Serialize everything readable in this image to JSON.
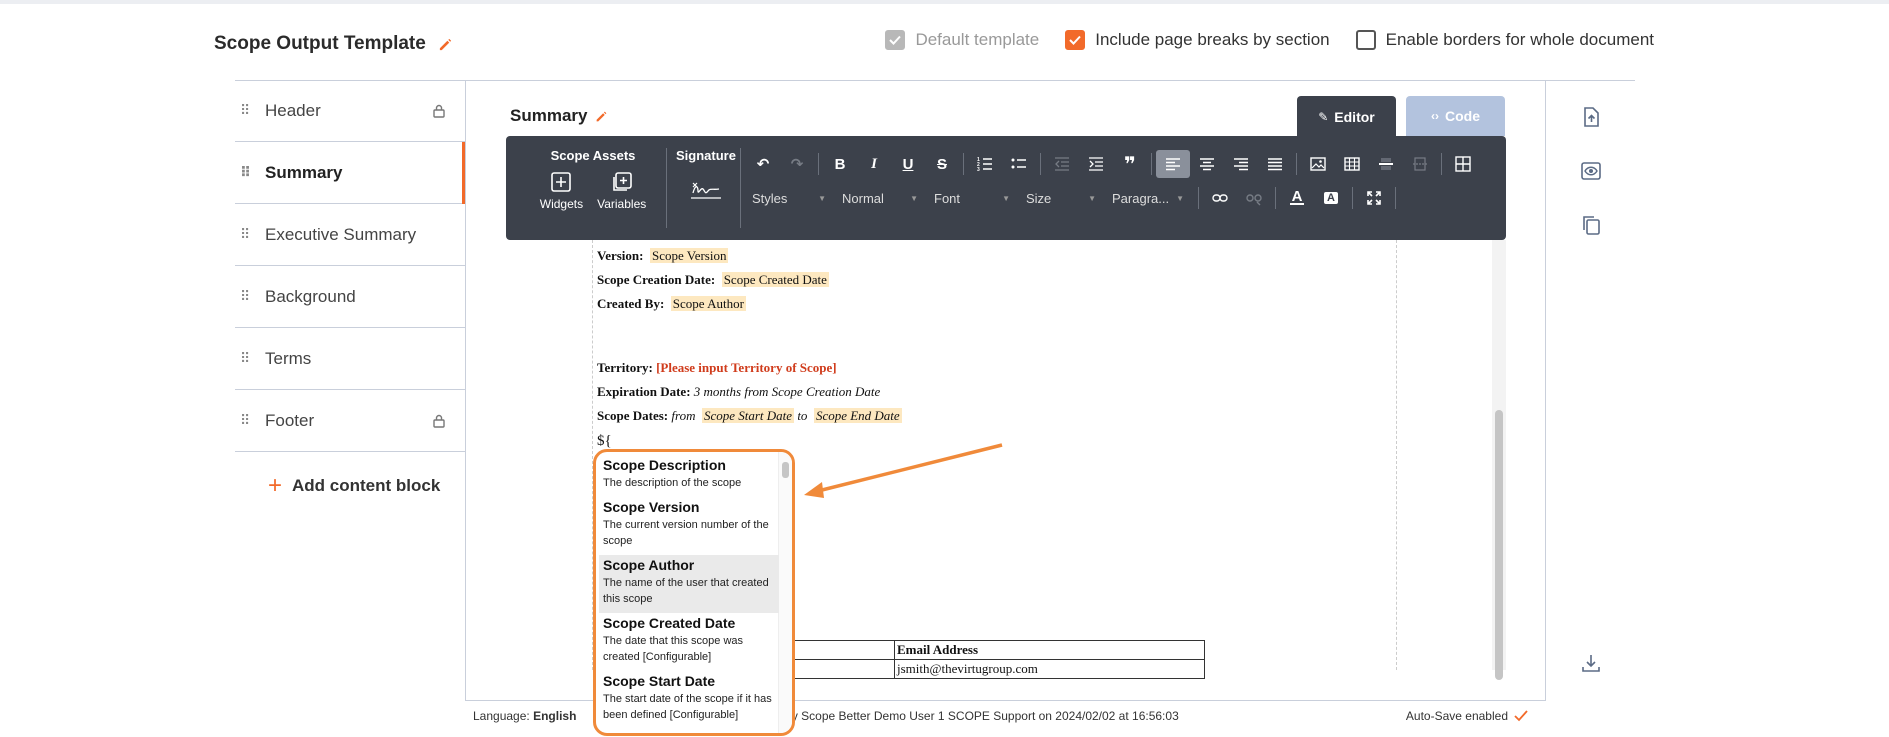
{
  "header": {
    "title": "Scope Output Template",
    "options": [
      {
        "label": "Default template",
        "checked": true,
        "disabled": true
      },
      {
        "label": "Include page breaks by section",
        "checked": true,
        "disabled": false
      },
      {
        "label": "Enable borders for whole document",
        "checked": false,
        "disabled": false
      }
    ]
  },
  "sidebar": {
    "items": [
      {
        "label": "Header",
        "locked": true
      },
      {
        "label": "Summary",
        "locked": false,
        "active": true
      },
      {
        "label": "Executive Summary",
        "locked": false
      },
      {
        "label": "Background",
        "locked": false
      },
      {
        "label": "Terms",
        "locked": false
      },
      {
        "label": "Footer",
        "locked": true
      }
    ],
    "add_label": "Add content block"
  },
  "editor": {
    "section_title": "Summary",
    "tabs": {
      "editor": "Editor",
      "code": "Code"
    },
    "toolbar": {
      "scope_assets": "Scope Assets",
      "widgets": "Widgets",
      "variables": "Variables",
      "signature": "Signature",
      "styles": "Styles",
      "format": "Normal",
      "font": "Font",
      "size": "Size",
      "paragraph": "Paragra..."
    }
  },
  "document": {
    "version_label": "Version:",
    "version_value": "Scope Version",
    "created_date_label": "Scope Creation Date:",
    "created_date_value": "Scope Created Date",
    "created_by_label": "Created By:",
    "created_by_value": "Scope Author",
    "territory_label": "Territory:",
    "territory_value": "[Please input Territory of Scope]",
    "expiration_label": "Expiration Date:",
    "expiration_value": "3 months from Scope Creation Date",
    "dates_label": "Scope Dates:",
    "dates_from": "from",
    "dates_start": "Scope Start Date",
    "dates_to": "to",
    "dates_end": "Scope End Date",
    "placeholder_open": "${",
    "table_header": "Email Address",
    "table_value": "jsmith@thevirtugroup.com"
  },
  "autocomplete": {
    "items": [
      {
        "title": "Scope Description",
        "desc": "The description of the scope"
      },
      {
        "title": "Scope Version",
        "desc": "The current version number of the scope"
      },
      {
        "title": "Scope Author",
        "desc": "The name of the user that created this scope"
      },
      {
        "title": "Scope Created Date",
        "desc": "The date that this scope was created [Configurable]"
      },
      {
        "title": "Scope Start Date",
        "desc": "The start date of the scope if it has been defined [Configurable]"
      }
    ]
  },
  "status": {
    "language_label": "Language:",
    "language_value": "English",
    "updated_text": "been updated by Scope Better Demo User 1 SCOPE Support on 2024/02/02 at 16:56:03",
    "autosave": "Auto-Save enabled"
  },
  "colors": {
    "accent": "#f26a2a",
    "toolbar": "#3c414b",
    "highlight": "#fde8c0",
    "callout": "#f08a3a"
  }
}
